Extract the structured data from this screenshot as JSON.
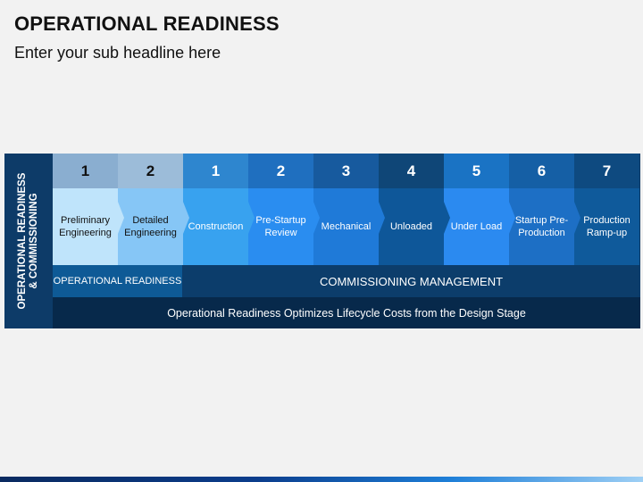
{
  "header": {
    "title": "OPERATIONAL READINESS",
    "subtitle": "Enter your sub headline here"
  },
  "side_label": "OPERATIONAL READINESS\n& COMMISSIONING",
  "stages": [
    {
      "number": "1",
      "label": "Preliminary Engineering",
      "num_bg": "#8aaed0",
      "num_color": "#111111",
      "bg": "#bfe4fb",
      "color": "#111111"
    },
    {
      "number": "2",
      "label": "Detailed Engineering",
      "num_bg": "#9cbcd9",
      "num_color": "#111111",
      "bg": "#86c6f6",
      "color": "#111111"
    },
    {
      "number": "1",
      "label": "Construction",
      "num_bg": "#2e86cf",
      "num_color": "#ffffff",
      "bg": "#38a2ef",
      "color": "#ffffff"
    },
    {
      "number": "2",
      "label": "Pre-Startup Review",
      "num_bg": "#1f6fbf",
      "num_color": "#ffffff",
      "bg": "#2a8df0",
      "color": "#ffffff"
    },
    {
      "number": "3",
      "label": "Mechanical",
      "num_bg": "#175a9e",
      "num_color": "#ffffff",
      "bg": "#1f7ad8",
      "color": "#ffffff"
    },
    {
      "number": "4",
      "label": "Unloaded",
      "num_bg": "#0f4677",
      "num_color": "#ffffff",
      "bg": "#0e5799",
      "color": "#ffffff"
    },
    {
      "number": "5",
      "label": "Under Load",
      "num_bg": "#1a73c4",
      "num_color": "#ffffff",
      "bg": "#2b8af0",
      "color": "#ffffff"
    },
    {
      "number": "6",
      "label": "Startup Pre-Production",
      "num_bg": "#155fa5",
      "num_color": "#ffffff",
      "bg": "#1d6fc5",
      "color": "#ffffff"
    },
    {
      "number": "7",
      "label": "Production Ramp-up",
      "num_bg": "#0e4a80",
      "num_color": "#ffffff",
      "bg": "#0f5a9b",
      "color": "#ffffff"
    }
  ],
  "bands": {
    "operational": "OPERATIONAL READINESS",
    "commissioning": "COMMISSIONING MANAGEMENT"
  },
  "footer_text": "Operational Readiness Optimizes Lifecycle Costs from the Design Stage"
}
